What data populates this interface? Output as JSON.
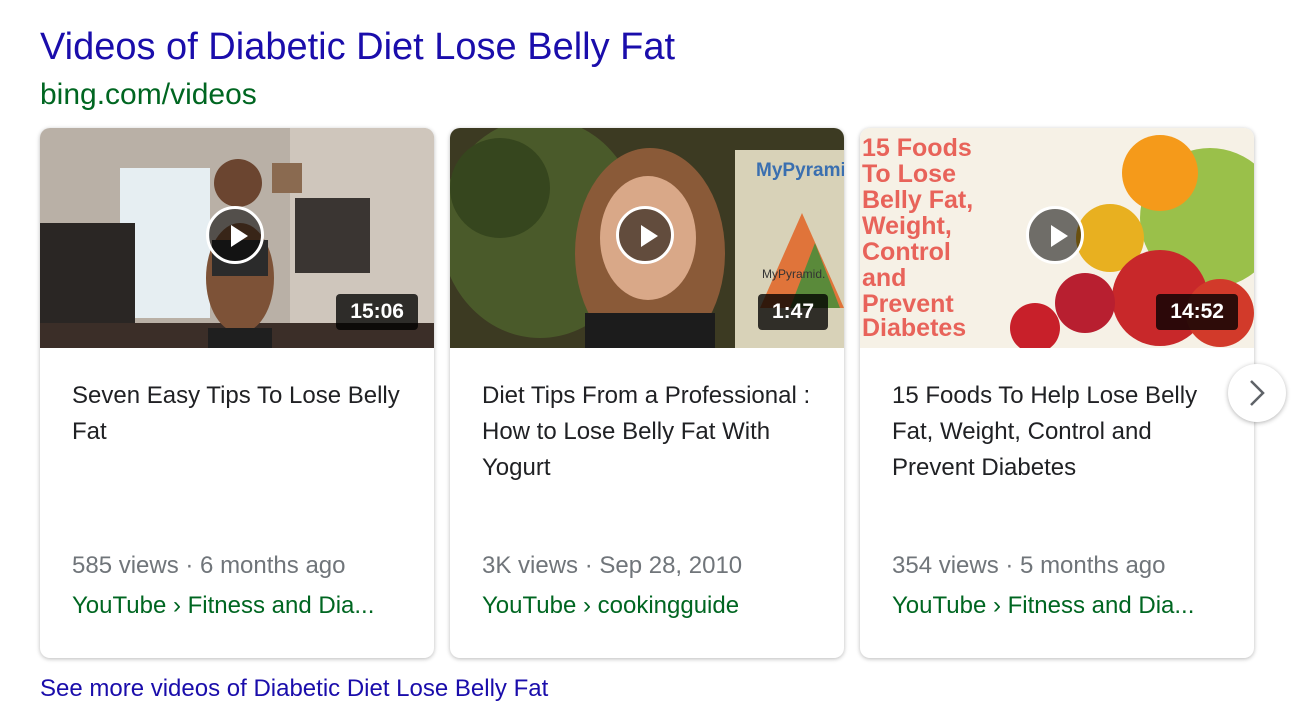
{
  "header": {
    "title": "Videos of Diabetic Diet Lose Belly Fat",
    "source": "bing.com/videos"
  },
  "videos": [
    {
      "title": "Seven Easy Tips To Lose Belly Fat",
      "duration": "15:06",
      "meta": "585 views · 6 months ago",
      "channel": "YouTube › Fitness and Dia..."
    },
    {
      "title": "Diet Tips From a Professional : How to Lose Belly Fat With Yogurt",
      "duration": "1:47",
      "meta": "3K views · Sep 28, 2010",
      "channel": "YouTube › cookingguide",
      "thumbnail_text": {
        "brand": "MyPyrami",
        "sub": "MyPyramid."
      }
    },
    {
      "title": "15 Foods To Help Lose Belly Fat, Weight, Control and Prevent Diabetes",
      "duration": "14:52",
      "meta": "354 views · 5 months ago",
      "channel": "YouTube › Fitness and Dia...",
      "thumbnail_text": [
        "15 Foods",
        "To Lose",
        "Belly Fat,",
        "Weight,",
        "Control",
        "and",
        "Prevent",
        "Diabetes"
      ]
    }
  ],
  "next_icon": "chevron-right-icon",
  "see_more": "See more videos of Diabetic Diet Lose Belly Fat",
  "colors": {
    "link": "#1a0dab",
    "url_green": "#006621",
    "meta_gray": "#70757a",
    "thumbnail_text": "#e8635a"
  }
}
